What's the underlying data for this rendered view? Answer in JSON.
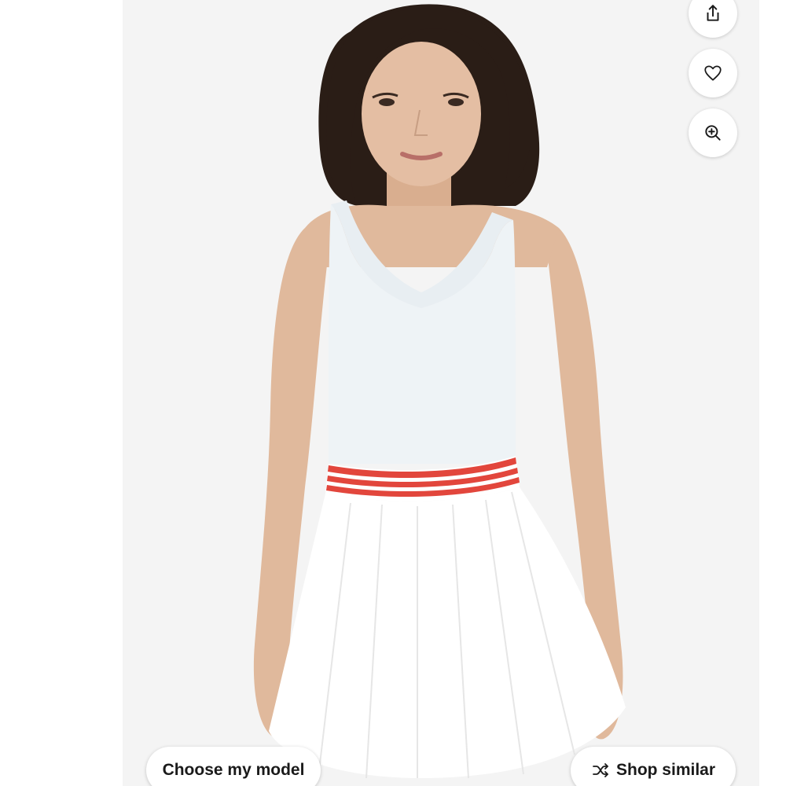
{
  "actions": {
    "share_icon": "share-icon",
    "favorite_icon": "heart-icon",
    "zoom_icon": "zoom-in-icon"
  },
  "footer": {
    "choose_model_label": "Choose my model",
    "shop_similar_label": "Shop similar",
    "shop_similar_icon": "shuffle-icon"
  },
  "colors": {
    "waistband_stripe": "#e2463c",
    "dress": "#ffffff",
    "hair": "#2a1d16",
    "skin": "#e0b99c",
    "background": "#f4f4f4"
  }
}
